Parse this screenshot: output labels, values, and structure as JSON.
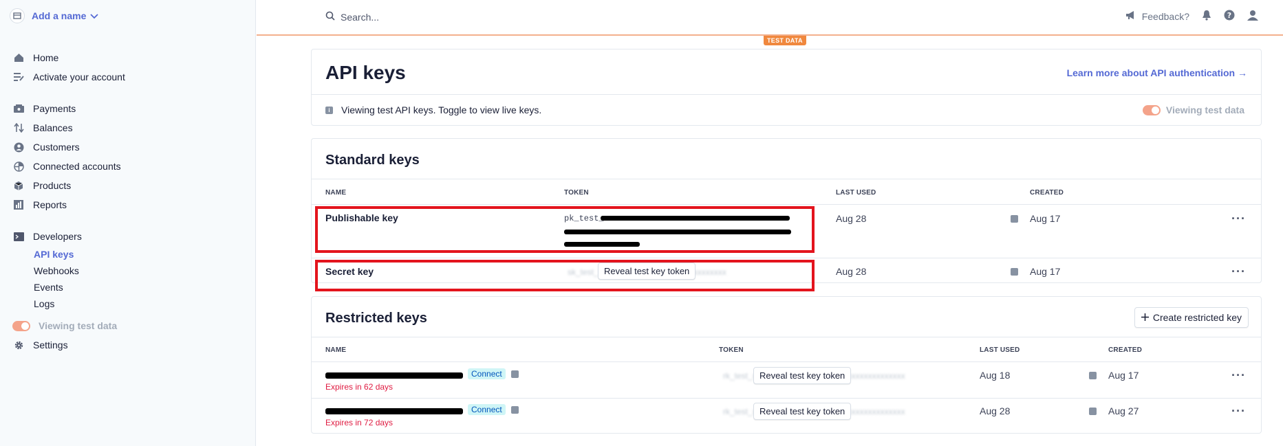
{
  "account": {
    "name": "Add a name"
  },
  "nav": {
    "home": "Home",
    "activate": "Activate your account",
    "payments": "Payments",
    "balances": "Balances",
    "customers": "Customers",
    "connected": "Connected accounts",
    "products": "Products",
    "reports": "Reports",
    "developers": "Developers",
    "api_keys": "API keys",
    "webhooks": "Webhooks",
    "events": "Events",
    "logs": "Logs",
    "viewing_test": "Viewing test data",
    "settings": "Settings"
  },
  "topbar": {
    "search_placeholder": "Search...",
    "feedback": "Feedback?",
    "test_badge": "TEST DATA"
  },
  "page": {
    "title": "API keys",
    "learn_more": "Learn more about API authentication →",
    "info": "Viewing test API keys. Toggle to view live keys.",
    "viewing_test": "Viewing test data"
  },
  "standard": {
    "title": "Standard keys",
    "columns": {
      "name": "NAME",
      "token": "TOKEN",
      "last_used": "LAST USED",
      "created": "CREATED"
    },
    "rows": [
      {
        "name": "Publishable key",
        "token_prefix": "pk_test_",
        "last_used": "Aug 28",
        "created": "Aug 17"
      },
      {
        "name": "Secret key",
        "reveal": "Reveal test key token",
        "last_used": "Aug 28",
        "created": "Aug 17"
      }
    ]
  },
  "restricted": {
    "title": "Restricted keys",
    "create": "Create restricted key",
    "columns": {
      "name": "NAME",
      "token": "TOKEN",
      "last_used": "LAST USED",
      "created": "CREATED"
    },
    "rows": [
      {
        "badge": "Connect",
        "expires": "Expires in 62 days",
        "reveal": "Reveal test key token",
        "last_used": "Aug 18",
        "created": "Aug 17"
      },
      {
        "badge": "Connect",
        "expires": "Expires in 72 days",
        "reveal": "Reveal test key token",
        "last_used": "Aug 28",
        "created": "Aug 27"
      }
    ]
  },
  "colors": {
    "accent": "#5469d4",
    "test_orange": "#f0883e",
    "highlight_red": "#e3141d"
  }
}
